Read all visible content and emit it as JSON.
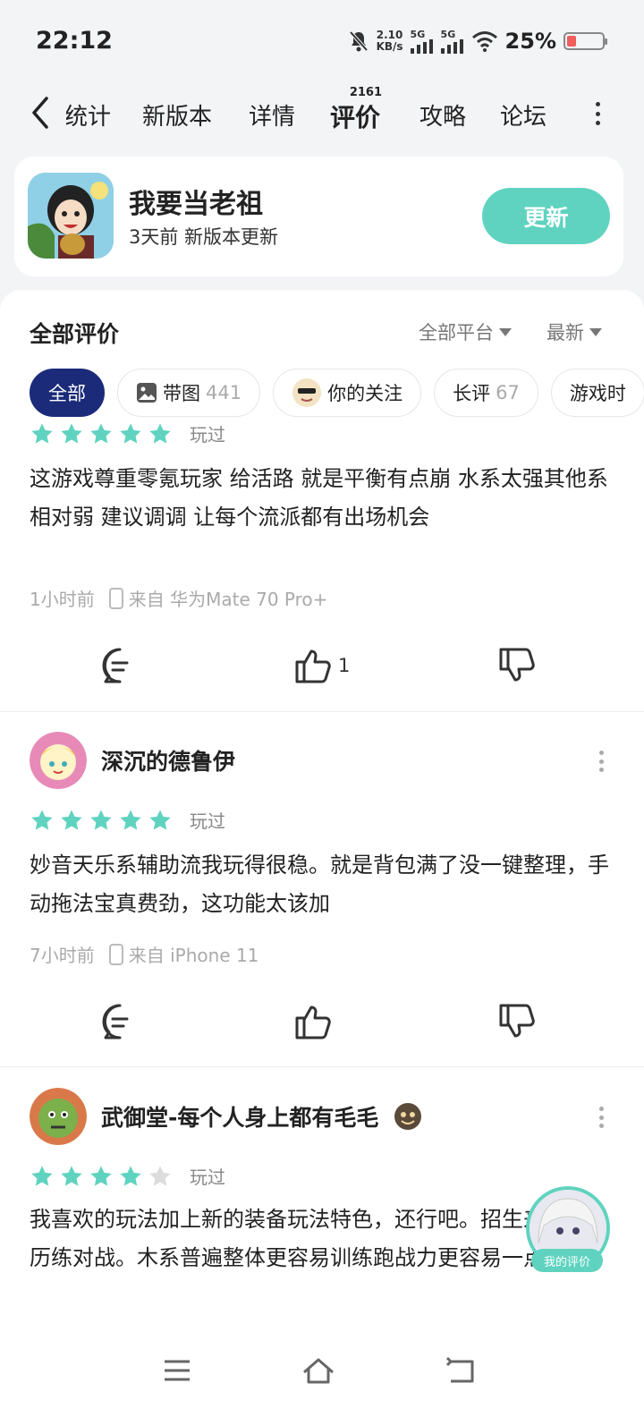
{
  "status": {
    "time": "22:12",
    "speed_top": "2.10",
    "speed_bottom": "KB/s",
    "net1": "5G",
    "net2": "5G",
    "battery": "25%"
  },
  "tabs": {
    "items": [
      "统计",
      "新版本",
      "详情",
      "评价",
      "攻略",
      "论坛"
    ],
    "active": "评价",
    "badge": "2161"
  },
  "app": {
    "name": "我要当老祖",
    "subtitle": "3天前 新版本更新",
    "update_label": "更新"
  },
  "reviews_header": {
    "title": "全部评价",
    "platform_filter": "全部平台",
    "sort_filter": "最新",
    "chips": [
      {
        "label": "全部",
        "count": ""
      },
      {
        "label": "带图",
        "count": "441"
      },
      {
        "label": "你的关注",
        "count": ""
      },
      {
        "label": "长评",
        "count": "67"
      },
      {
        "label": "游戏时",
        "count": ""
      }
    ]
  },
  "reviews": [
    {
      "username": "",
      "rating": 5,
      "status": "玩过",
      "text": "这游戏尊重零氪玩家 给活路 就是平衡有点崩 水系太强其他系相对弱 建议调调 让每个流派都有出场机会",
      "time": "1小时前",
      "device": "来自 华为Mate 70 Pro+",
      "likes": "1"
    },
    {
      "username": "深沉的德鲁伊",
      "rating": 5,
      "status": "玩过",
      "text": "妙音天乐系辅助流我玩得很稳。就是背包满了没一键整理，手动拖法宝真费劲，这功能太该加",
      "time": "7小时前",
      "device": "来自 iPhone 11",
      "likes": ""
    },
    {
      "username": "武御堂-每个人身上都有毛毛",
      "rating": 4,
      "status": "玩过",
      "text": "我喜欢的玩法加上新的装备玩法特色，还行吧。招生来玩一局历练对战。木系普遍整体更容易训练跑战力更容易一点！~",
      "time": "",
      "device": "",
      "likes": ""
    }
  ],
  "float_button": {
    "label": "我的评价"
  },
  "colors": {
    "accent": "#5fd3c0",
    "chip_active": "#1b2b7a"
  }
}
